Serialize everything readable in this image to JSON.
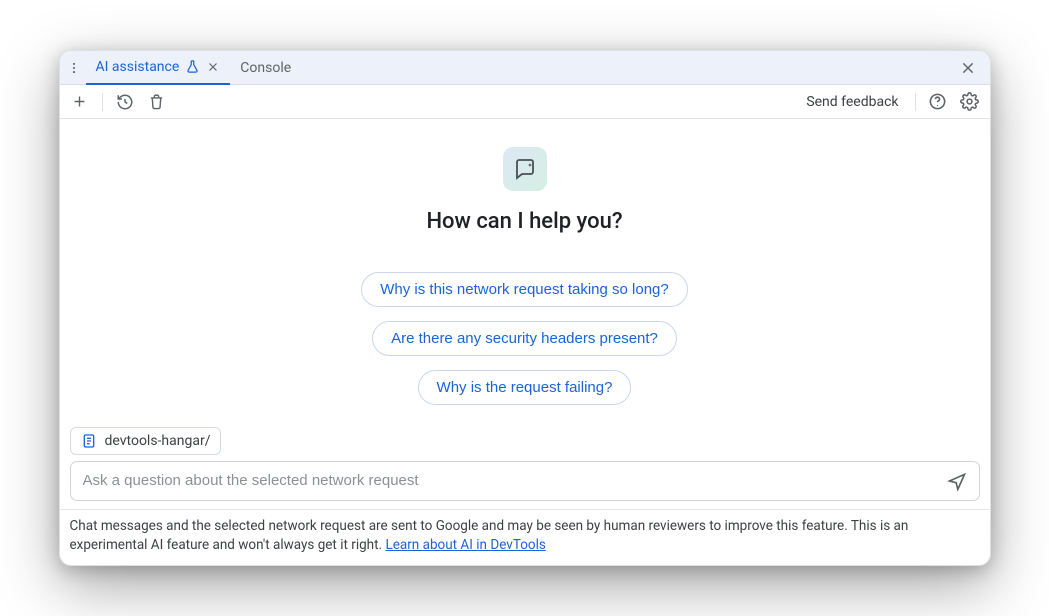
{
  "tabs": {
    "active": {
      "label": "AI assistance"
    },
    "other": {
      "label": "Console"
    }
  },
  "toolbar": {
    "send_feedback_label": "Send feedback"
  },
  "hero": {
    "title": "How can I help you?"
  },
  "suggestions": [
    "Why is this network request taking so long?",
    "Are there any security headers present?",
    "Why is the request failing?"
  ],
  "context": {
    "label": "devtools-hangar/"
  },
  "input": {
    "placeholder": "Ask a question about the selected network request"
  },
  "footer": {
    "text": "Chat messages and the selected network request are sent to Google and may be seen by human reviewers to improve this feature. This is an experimental AI feature and won't always get it right. ",
    "link_text": "Learn about AI in DevTools"
  }
}
